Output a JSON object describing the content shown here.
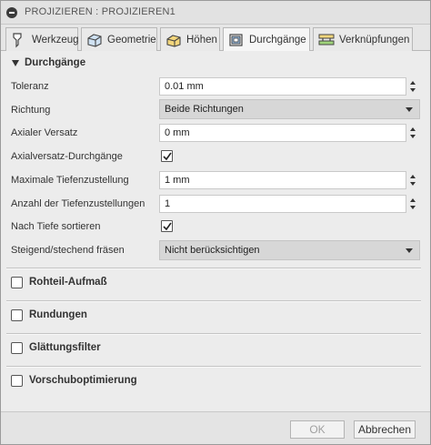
{
  "window": {
    "title": "PROJIZIEREN : PROJIZIEREN1"
  },
  "tabs": [
    {
      "label": "Werkzeug",
      "icon": "tool-icon"
    },
    {
      "label": "Geometrie",
      "icon": "geometry-cube-icon"
    },
    {
      "label": "Höhen",
      "icon": "heights-icon"
    },
    {
      "label": "Durchgänge",
      "icon": "passes-icon",
      "active": true
    },
    {
      "label": "Verknüpfungen",
      "icon": "linking-icon"
    }
  ],
  "passes_section": {
    "title": "Durchgänge",
    "tolerance": {
      "label": "Toleranz",
      "value": "0.01 mm"
    },
    "direction": {
      "label": "Richtung",
      "value": "Beide Richtungen"
    },
    "axial_offset": {
      "label": "Axialer Versatz",
      "value": "0 mm"
    },
    "axial_offset_passes": {
      "label": "Axialversatz-Durchgänge",
      "checked": true
    },
    "max_stepdown": {
      "label": "Maximale Tiefenzustellung",
      "value": "1 mm"
    },
    "stepdown_count": {
      "label": "Anzahl der Tiefenzustellungen",
      "value": "1"
    },
    "order_by_depth": {
      "label": "Nach Tiefe sortieren",
      "checked": true
    },
    "milling_direction": {
      "label": "Steigend/stechend fräsen",
      "value": "Nicht berücksichtigen"
    }
  },
  "collapsed_sections": [
    {
      "label": "Rohteil-Aufmaß",
      "checked": false
    },
    {
      "label": "Rundungen",
      "checked": false
    },
    {
      "label": "Glättungsfilter",
      "checked": false
    },
    {
      "label": "Vorschuboptimierung",
      "checked": false
    }
  ],
  "footer": {
    "ok_label": "OK",
    "cancel_label": "Abbrechen"
  },
  "colors": {
    "panel": "#ececec",
    "field": "#ffffff",
    "select": "#d7d7d7",
    "disabled_text": "#a0a0a0"
  }
}
